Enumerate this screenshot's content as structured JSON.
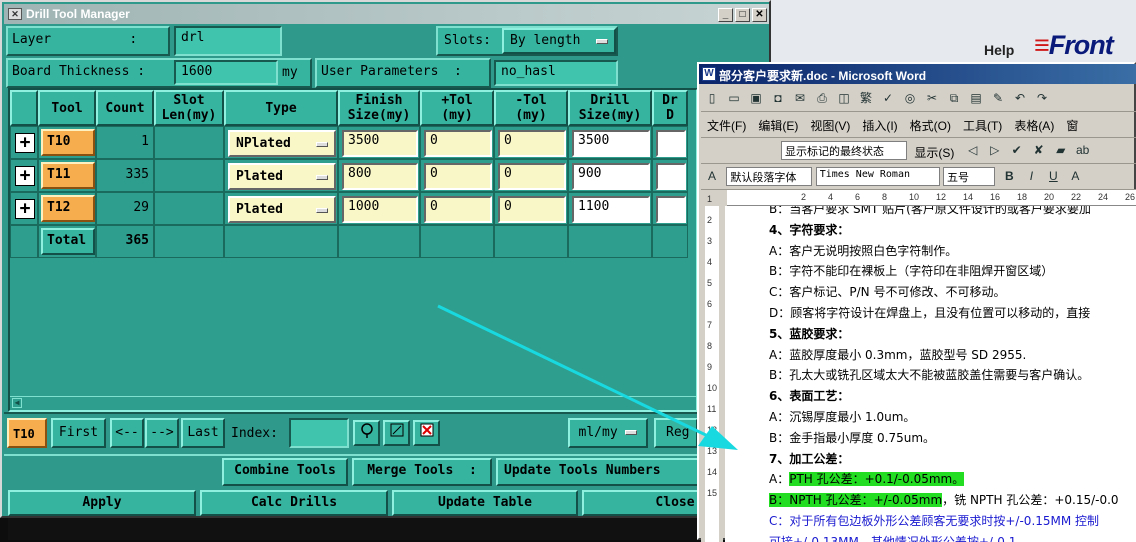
{
  "background_app": {
    "help_label": "Help",
    "logo_text": "Front"
  },
  "drill_manager": {
    "title": "Drill Tool Manager",
    "layer_label": "Layer          :",
    "layer_value": "drl",
    "slots_label": "Slots:",
    "slots_value": "By length",
    "board_thickness_label": "Board Thickness :",
    "board_thickness_value": "1600",
    "board_thickness_unit": "my",
    "user_params_label": "User Parameters  :",
    "user_params_value": "no_hasl",
    "headers": [
      "Tool",
      "Count",
      "Slot\nLen(my)",
      "Type",
      "Finish\nSize(my)",
      "+Tol\n(my)",
      "-Tol\n(my)",
      "Drill\nSize(my)",
      "Dr\nD"
    ],
    "rows": [
      {
        "expand": "+",
        "tool": "T10",
        "count": "1",
        "type": "NPlated",
        "finish": "3500",
        "ptol": "0",
        "ntol": "0",
        "drill": "3500"
      },
      {
        "expand": "+",
        "tool": "T11",
        "count": "335",
        "type": "Plated",
        "finish": "800",
        "ptol": "0",
        "ntol": "0",
        "drill": "900"
      },
      {
        "expand": "+",
        "tool": "T12",
        "count": "29",
        "type": "Plated",
        "finish": "1000",
        "ptol": "0",
        "ntol": "0",
        "drill": "1100"
      }
    ],
    "total_label": "Total",
    "total_count": "365",
    "nav": {
      "current_tool": "T10",
      "first": "First",
      "prev": "<--",
      "next": "-->",
      "last": "Last",
      "index_label": "Index:",
      "index_value": "",
      "units": "ml/my",
      "reg": "Reg"
    },
    "actions": {
      "combine": "Combine Tools",
      "merge": "Merge Tools  :",
      "update_numbers": "Update Tools Numbers"
    },
    "bottom": {
      "apply": "Apply",
      "calc": "Calc Drills",
      "update_table": "Update Table",
      "close": "Close"
    }
  },
  "word": {
    "title": "部分客户要求新.doc - Microsoft Word",
    "menu": [
      "文件(F)",
      "编辑(E)",
      "视图(V)",
      "插入(I)",
      "格式(O)",
      "工具(T)",
      "表格(A)",
      "窗"
    ],
    "toolbar_simplified": "繁",
    "markup_combo": "显示标记的最终状态",
    "show_label": "显示(S)",
    "style": "默认段落字体",
    "font": "Times New Roman",
    "size": "五号",
    "ruler_numbers": [
      "2",
      "4",
      "6",
      "8",
      "10",
      "12",
      "14",
      "16",
      "18",
      "20",
      "22",
      "24",
      "26",
      "28"
    ],
    "vruler_numbers": [
      "1",
      "2",
      "3",
      "4",
      "5",
      "6",
      "7",
      "8",
      "9",
      "10",
      "11",
      "12",
      "13",
      "14",
      "15"
    ],
    "lines": [
      {
        "text": "B：当客户要求 SMT 贴片(客户原文件设计的或客户要求要加",
        "cls": ""
      },
      {
        "text": "4、字符要求：",
        "cls": "bold"
      },
      {
        "text": "A：客户无说明按照白色字符制作。",
        "cls": ""
      },
      {
        "text": "B：字符不能印在裸板上（字符印在非阻焊开窗区域）",
        "cls": ""
      },
      {
        "text": "C：客户标记、P/N 号不可修改、不可移动。",
        "cls": ""
      },
      {
        "text": "D：顾客将字符设计在焊盘上，且没有位置可以移动的，直接",
        "cls": ""
      },
      {
        "text": "5、蓝胶要求：",
        "cls": "bold"
      },
      {
        "text": "A：蓝胶厚度最小 0.3mm，蓝胶型号 SD 2955.",
        "cls": ""
      },
      {
        "text": "B：孔太大或铣孔区域太大不能被蓝胶盖住需要与客户确认。",
        "cls": ""
      },
      {
        "text": "6、表面工艺：",
        "cls": "bold"
      },
      {
        "text": "A：沉锡厚度最小 1.0um。",
        "cls": ""
      },
      {
        "text": "B：金手指最小厚度 0.75um。",
        "cls": ""
      },
      {
        "text": "7、加工公差：",
        "cls": "bold"
      },
      {
        "text": "A：",
        "hl": "PTH 孔公差：+0.1/-0.05mm。",
        "cls": ""
      },
      {
        "text": "",
        "hl": "B：NPTH 孔公差：+/-0.05mm",
        "tail": "，铣 NPTH 孔公差：+0.15/-0.0",
        "cls": ""
      },
      {
        "text": "C：对于所有包边板外形公差顾客无要求时按+/-0.15MM 控制",
        "cls": "blue"
      },
      {
        "text": "可接+/-0.13MM，其他情况外形公差按+/-0.1",
        "cls": "blue"
      }
    ]
  },
  "colors": {
    "teal": "#37b4a0",
    "cell_yellow": "#f9f7c8",
    "tool_orange": "#f6ad4e",
    "highlight": "#22dd22",
    "arrow": "#19d9e0"
  }
}
